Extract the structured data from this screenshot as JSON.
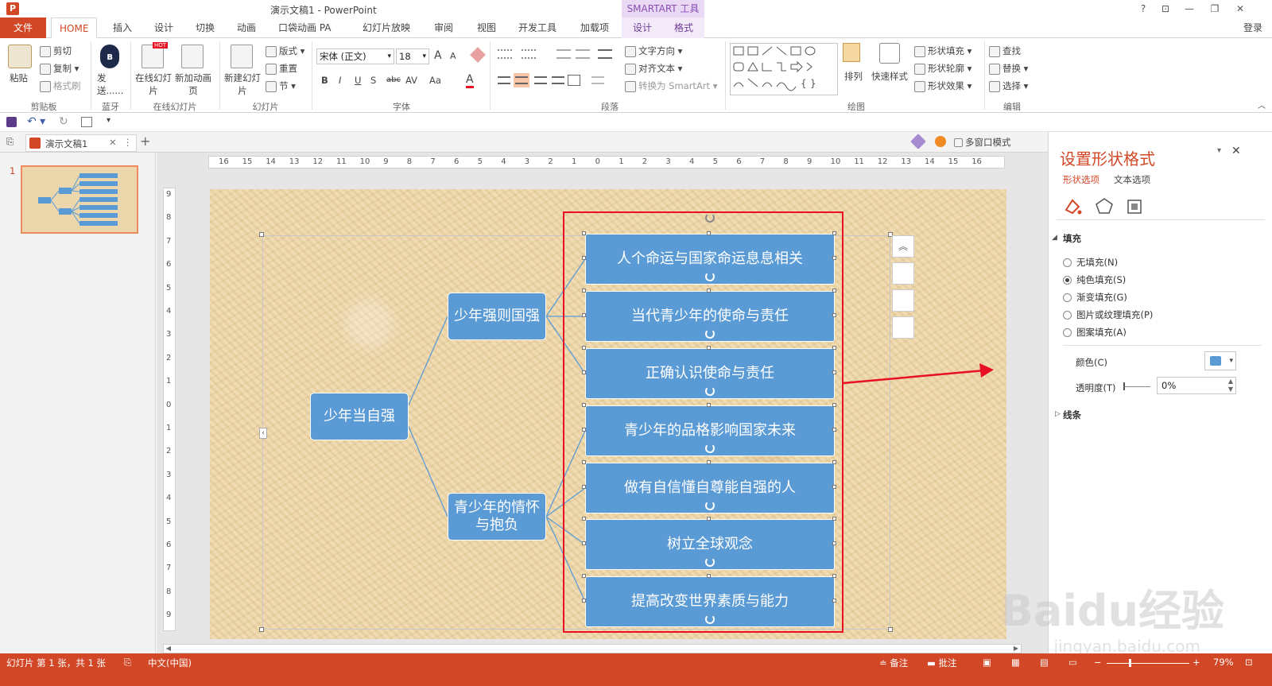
{
  "window": {
    "title": "演示文稿1 - PowerPoint",
    "contextual_group": "SMARTART 工具",
    "help": "?",
    "ribbon_display": "⊡",
    "minimize": "—",
    "restore": "❐",
    "close": "✕",
    "signin": "登录"
  },
  "tabs": {
    "file": "文件",
    "home": "HOME",
    "insert": "插入",
    "design": "设计",
    "transitions": "切换",
    "animations": "动画",
    "pocket": "口袋动画 PA",
    "slideshow": "幻灯片放映",
    "review": "审阅",
    "view": "视图",
    "developer": "开发工具",
    "addins": "加载项",
    "sa_design": "设计",
    "sa_format": "格式"
  },
  "ribbon": {
    "clipboard": {
      "paste": "粘贴",
      "cut": "剪切",
      "copy": "复制",
      "format_painter": "格式刷",
      "label": "剪贴板"
    },
    "bluetooth": {
      "send": "发送......",
      "label": "蓝牙"
    },
    "online": {
      "online_slide": "在线幻灯片",
      "new_anim_page": "新加动画页",
      "label": "在线幻灯片"
    },
    "slides": {
      "new_slide": "新建幻灯片",
      "layout": "版式",
      "reset": "重置",
      "section": "节",
      "label": "幻灯片"
    },
    "font": {
      "font_name": "宋体 (正文)",
      "font_size": "18",
      "bold": "B",
      "italic": "I",
      "underline": "U",
      "shadow": "S",
      "strike": "abc",
      "spacing": "AV",
      "case": "Aa",
      "color": "A",
      "grow": "A",
      "shrink": "A",
      "label": "字体"
    },
    "paragraph": {
      "text_direction": "文字方向",
      "align_text": "对齐文本",
      "convert_smartart": "转换为 SmartArt",
      "label": "段落"
    },
    "drawing": {
      "arrange": "排列",
      "quick_styles": "快速样式",
      "shape_fill": "形状填充",
      "shape_outline": "形状轮廓",
      "shape_effects": "形状效果",
      "label": "绘图"
    },
    "editing": {
      "find": "查找",
      "replace": "替换",
      "select": "选择",
      "label": "编辑"
    }
  },
  "doc_tab": {
    "name": "演示文稿1",
    "multi_window": "多窗口模式"
  },
  "thumbnail": {
    "number": "1"
  },
  "ruler": {
    "h_ticks": [
      "16",
      "15",
      "14",
      "13",
      "12",
      "11",
      "10",
      "9",
      "8",
      "7",
      "6",
      "5",
      "4",
      "3",
      "2",
      "1",
      "0",
      "1",
      "2",
      "3",
      "4",
      "5",
      "6",
      "7",
      "8",
      "9",
      "10",
      "11",
      "12",
      "13",
      "14",
      "15",
      "16"
    ],
    "v_ticks": [
      "9",
      "8",
      "7",
      "6",
      "5",
      "4",
      "3",
      "2",
      "1",
      "0",
      "1",
      "2",
      "3",
      "4",
      "5",
      "6",
      "7",
      "8",
      "9"
    ]
  },
  "smartart": {
    "root": "少年当自强",
    "branch1": "少年强则国强",
    "branch2": "青少年的情怀与抱负",
    "leaves": [
      "人个命运与国家命运息息相关",
      "当代青少年的使命与责任",
      "正确认识使命与责任",
      "青少年的品格影响国家未来",
      "做有自信懂自尊能自强的人",
      "树立全球观念",
      "提高改变世界素质与能力"
    ]
  },
  "format_pane": {
    "title": "设置形状格式",
    "tab_shape": "形状选项",
    "tab_text": "文本选项",
    "fill_section": "填充",
    "no_fill": "无填充(N)",
    "solid_fill": "纯色填充(S)",
    "gradient_fill": "渐变填充(G)",
    "picture_fill": "图片或纹理填充(P)",
    "pattern_fill": "图案填充(A)",
    "color_label": "颜色(C)",
    "transparency_label": "透明度(T)",
    "transparency_value": "0%",
    "line_section": "线条"
  },
  "status": {
    "slide_info": "幻灯片 第 1 张，共 1 张",
    "language": "中文(中国)",
    "notes": "备注",
    "comments": "批注",
    "zoom": "79%"
  },
  "watermark": {
    "main": "Baidu经验",
    "sub": "jingyan.baidu.com"
  },
  "colors": {
    "accent": "#d24726",
    "node_fill": "#5b9bd5",
    "highlight": "#e81123",
    "contextual": "#8a4db3"
  }
}
